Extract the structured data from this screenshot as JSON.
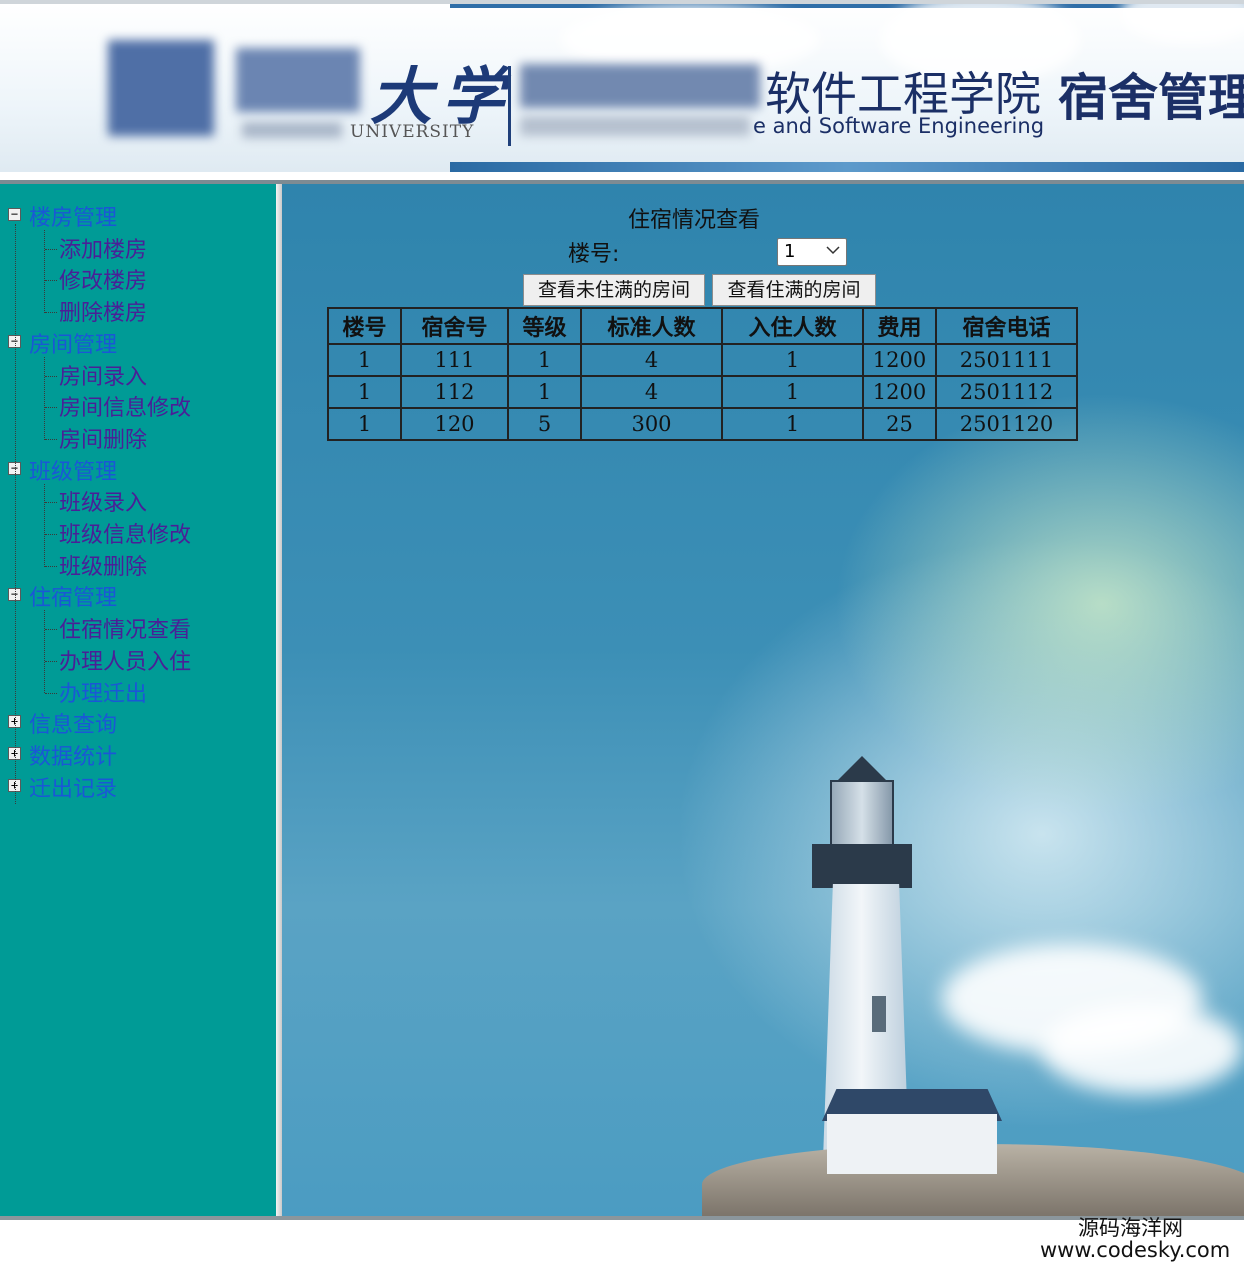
{
  "header": {
    "university_cn": "大学",
    "university_en": "UNIVERSITY",
    "college_cn": "软件工程学院",
    "college_en": "e and Software Engineering",
    "system_cn": "宿舍管理"
  },
  "sidebar": {
    "groups": [
      {
        "label": "楼房管理",
        "expanded": true,
        "items": [
          "添加楼房",
          "修改楼房",
          "删除楼房"
        ]
      },
      {
        "label": "房间管理",
        "expanded": true,
        "items": [
          "房间录入",
          "房间信息修改",
          "房间删除"
        ]
      },
      {
        "label": "班级管理",
        "expanded": true,
        "items": [
          "班级录入",
          "班级信息修改",
          "班级删除"
        ]
      },
      {
        "label": "住宿管理",
        "expanded": true,
        "items": [
          "住宿情况查看",
          "办理人员入住",
          "办理迁出"
        ]
      },
      {
        "label": "信息查询",
        "expanded": false,
        "items": []
      },
      {
        "label": "数据统计",
        "expanded": false,
        "items": []
      },
      {
        "label": "迁出记录",
        "expanded": false,
        "items": []
      }
    ],
    "toggle_expanded": "−",
    "toggle_collapsed": "+"
  },
  "main": {
    "title": "住宿情况查看",
    "floor_label": "楼号:",
    "floor_select_value": "1",
    "btn_unfull": "查看未住满的房间",
    "btn_full": "查看住满的房间",
    "table": {
      "headers": [
        "楼号",
        "宿舍号",
        "等级",
        "标准人数",
        "入住人数",
        "费用",
        "宿舍电话"
      ],
      "rows": [
        [
          "1",
          "111",
          "1",
          "4",
          "1",
          "1200",
          "2501111"
        ],
        [
          "1",
          "112",
          "1",
          "4",
          "1",
          "1200",
          "2501112"
        ],
        [
          "1",
          "120",
          "5",
          "300",
          "1",
          "25",
          "2501120"
        ]
      ]
    }
  },
  "watermark": {
    "line1": "源码海洋网",
    "line2": "www.codesky.com"
  },
  "colors": {
    "sidebar_bg": "#009b96",
    "group_link": "#1a57d6",
    "item_link": "#4a1f97"
  }
}
